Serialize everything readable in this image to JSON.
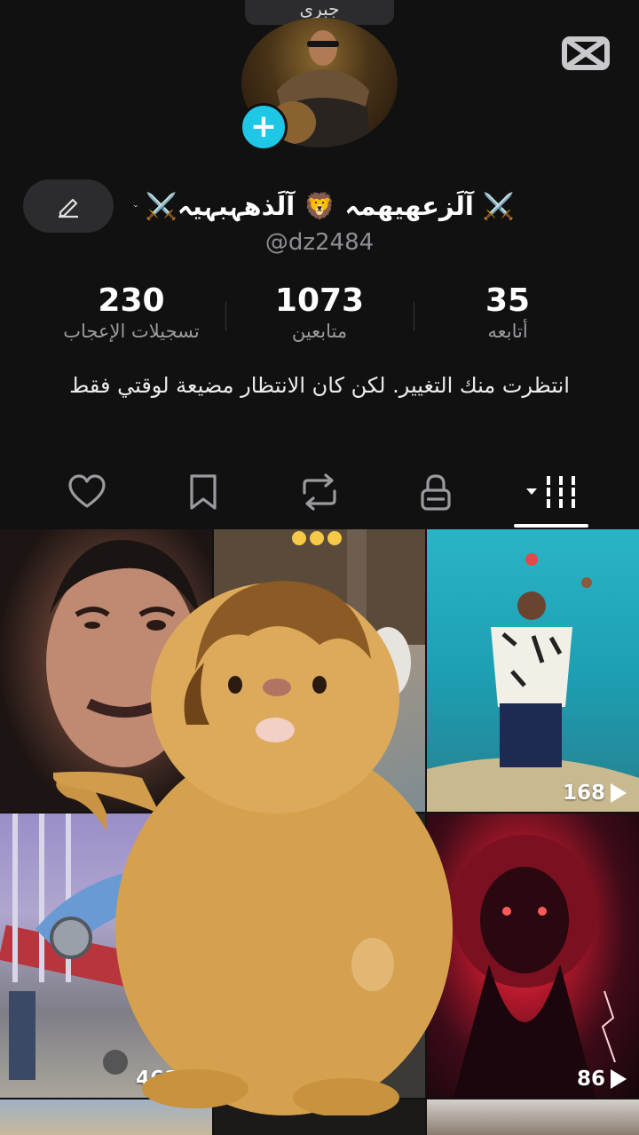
{
  "top_pill_text": "جبرى",
  "profile": {
    "display_name": "⚔️آلَزعهيهمہ 🦁 آلَذهہبہيہ ⚔️",
    "username": "@dz2484",
    "bio": "انتظرت منك التغيير. لكن كان الانتظار مضيعة لوقتي فقط"
  },
  "stats": [
    {
      "value": "35",
      "label": "أتابعه"
    },
    {
      "value": "1073",
      "label": "متابعين"
    },
    {
      "value": "230",
      "label": "تسجيلات الإعجاب"
    }
  ],
  "tabs": [
    {
      "icon": "videos-grid-icon",
      "active": true
    },
    {
      "icon": "lock-icon"
    },
    {
      "icon": "repost-icon"
    },
    {
      "icon": "bookmark-icon"
    },
    {
      "icon": "heart-icon"
    }
  ],
  "videos": [
    {
      "views": ""
    },
    {
      "views": ""
    },
    {
      "views": "168"
    },
    {
      "views": "461"
    },
    {
      "views": ""
    },
    {
      "views": "86"
    }
  ],
  "colors": {
    "background": "#111112",
    "accent": "#1fc7e6",
    "muted": "#8e8e93"
  }
}
